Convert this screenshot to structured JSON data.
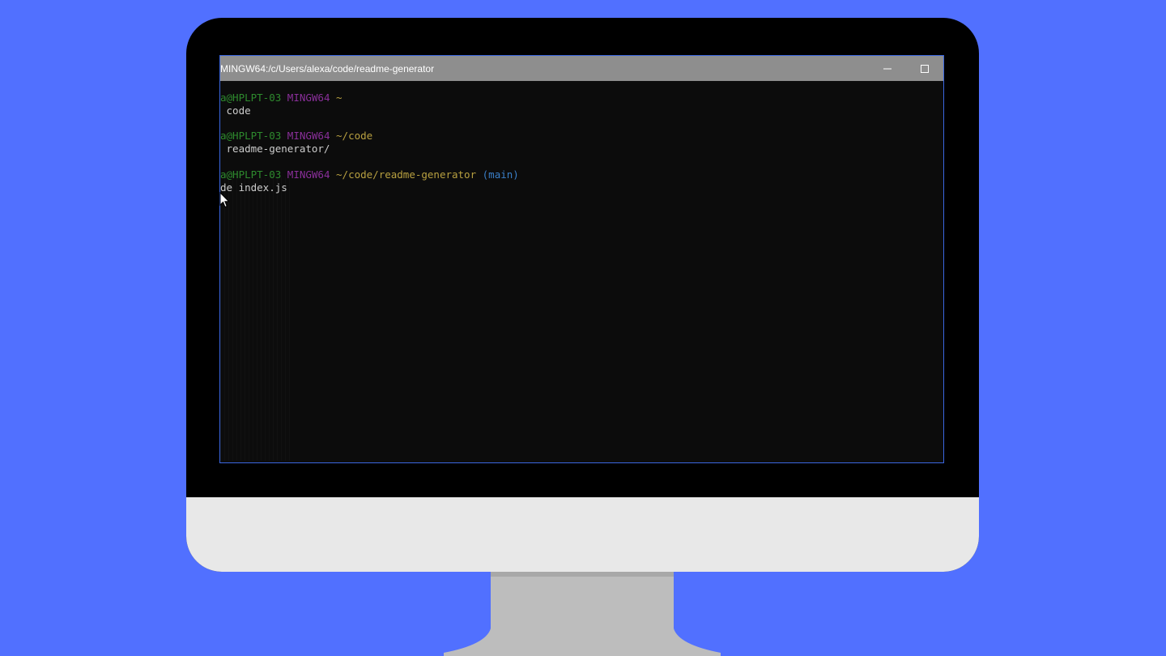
{
  "colors": {
    "background": "#5170FF",
    "bezel": "#000000",
    "chin": "#E8E8E8",
    "stand": "#BDBDBD",
    "terminal_bg": "#0C0C0C",
    "titlebar": "#8E8E8E",
    "prompt_user": "#2E8B2E",
    "prompt_host": "#8A2F9A",
    "prompt_path": "#B8A040",
    "prompt_branch": "#3A7FC8"
  },
  "window": {
    "title": "MINGW64:/c/Users/alexa/code/readme-generator",
    "minimize_icon": "minimize-icon",
    "maximize_icon": "maximize-icon"
  },
  "terminal": {
    "blocks": [
      {
        "user": "a@HPLPT-03",
        "host": "MINGW64",
        "path": "~",
        "branch": "",
        "command": " code"
      },
      {
        "user": "a@HPLPT-03",
        "host": "MINGW64",
        "path": "~/code",
        "branch": "",
        "command": " readme-generator/"
      },
      {
        "user": "a@HPLPT-03",
        "host": "MINGW64",
        "path": "~/code/readme-generator",
        "branch": "(main)",
        "command": "de index.js"
      }
    ]
  },
  "cursor_icon": "mouse-pointer-icon"
}
